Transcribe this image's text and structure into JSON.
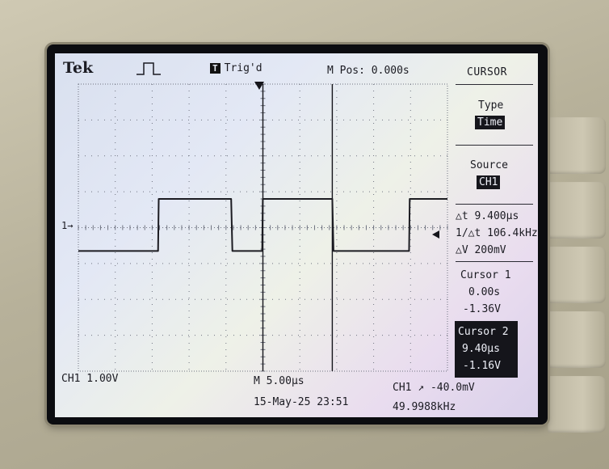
{
  "header": {
    "brand": "Tek",
    "trigger_status_box": "T",
    "trigger_status": "Trig'd",
    "main_position": "M Pos: 0.000s"
  },
  "menu": {
    "title": "CURSOR",
    "type": {
      "label": "Type",
      "value": "Time"
    },
    "source": {
      "label": "Source",
      "value": "CH1"
    },
    "deltas": {
      "delta_t": "△t 9.400µs",
      "inv_delta_t": "1/△t  106.4kHz",
      "delta_v": "△V 200mV"
    },
    "cursor1": {
      "label": "Cursor 1",
      "time": "0.00s",
      "volts": "-1.36V"
    },
    "cursor2": {
      "label": "Cursor 2",
      "time": "9.40µs",
      "volts": "-1.16V"
    }
  },
  "footer": {
    "ch1_scale": "CH1  1.00V",
    "timebase": "M 5.00µs",
    "trigger": "CH1 ↗ -40.0mV",
    "datetime": "15-May-25 23:51",
    "frequency": "49.9988kHz"
  },
  "markers": {
    "ch1": "1→"
  },
  "waveform": {
    "channel": "CH1",
    "volts_per_div": 1.0,
    "time_per_div_us": 5.0,
    "horizontal_divisions": 10,
    "vertical_divisions": 8,
    "high_level_v": 0.8,
    "low_level_v": -0.65,
    "edges_us": [
      -14.2,
      -4.3,
      -0.1,
      9.4,
      19.8
    ],
    "cursor_times_us": [
      0.0,
      9.4
    ]
  },
  "colors": {
    "trace": "#1c1c22",
    "graticule": "#6f7380",
    "cursor_line": "#15151b"
  },
  "icons": {
    "pulse_mode": "rising-pulse-icon",
    "trigger_marker": "down-triangle-icon",
    "trigger_level": "left-arrow-icon"
  }
}
